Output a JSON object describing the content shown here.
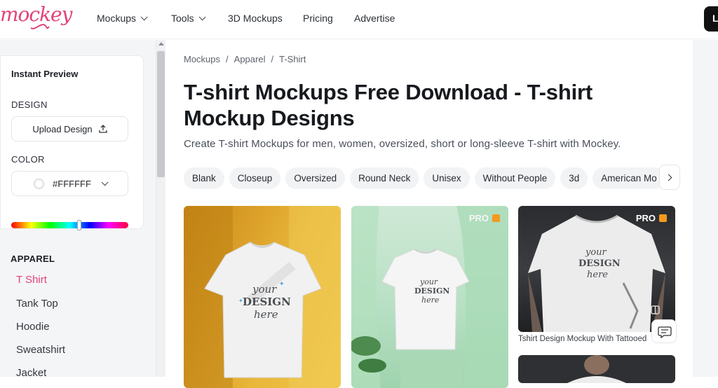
{
  "brand": {
    "logo_text": "mockey",
    "accent": "#e2427a"
  },
  "nav": {
    "items": [
      {
        "label": "Mockups",
        "has_menu": true
      },
      {
        "label": "Tools",
        "has_menu": true
      },
      {
        "label": "3D Mockups",
        "has_menu": false
      },
      {
        "label": "Pricing",
        "has_menu": false
      },
      {
        "label": "Advertise",
        "has_menu": false
      }
    ],
    "login_label": "L"
  },
  "sidebar": {
    "preview_title": "Instant Preview",
    "design_label": "DESIGN",
    "upload_label": "Upload Design",
    "color_label": "COLOR",
    "color_value": "#FFFFFF",
    "hue_level": 0.58,
    "apparel_title": "APPAREL",
    "apparel_items": [
      {
        "label": "T Shirt",
        "active": true
      },
      {
        "label": "Tank Top",
        "active": false
      },
      {
        "label": "Hoodie",
        "active": false
      },
      {
        "label": "Sweatshirt",
        "active": false
      },
      {
        "label": "Jacket",
        "active": false
      }
    ]
  },
  "main": {
    "breadcrumb": [
      "Mockups",
      "Apparel",
      "T-Shirt"
    ],
    "title": "T-shirt Mockups Free Download - T-shirt Mockup Designs",
    "subtitle": "Create T-shirt Mockups for men, women, oversized, short or long-sleeve T-shirt with Mockey.",
    "chips": [
      "Blank",
      "Closeup",
      "Oversized",
      "Round Neck",
      "Unisex",
      "Without People",
      "3d",
      "American Mo"
    ],
    "cards": [
      {
        "badge": "",
        "design_text": [
          "your",
          "DESIGN",
          "here"
        ]
      },
      {
        "badge": "PRO",
        "design_text": [
          "your",
          "DESIGN",
          "here"
        ]
      },
      {
        "badge": "PRO",
        "design_text": [
          "your",
          "DESIGN",
          "here"
        ],
        "caption": "Tshirt Design Mockup With Tattooed"
      }
    ]
  },
  "icons": {
    "upload": "upload-icon",
    "chevron": "chevron-down-icon",
    "next": "chevron-right-icon",
    "chat": "chat-icon",
    "compare": "compare-icon"
  }
}
